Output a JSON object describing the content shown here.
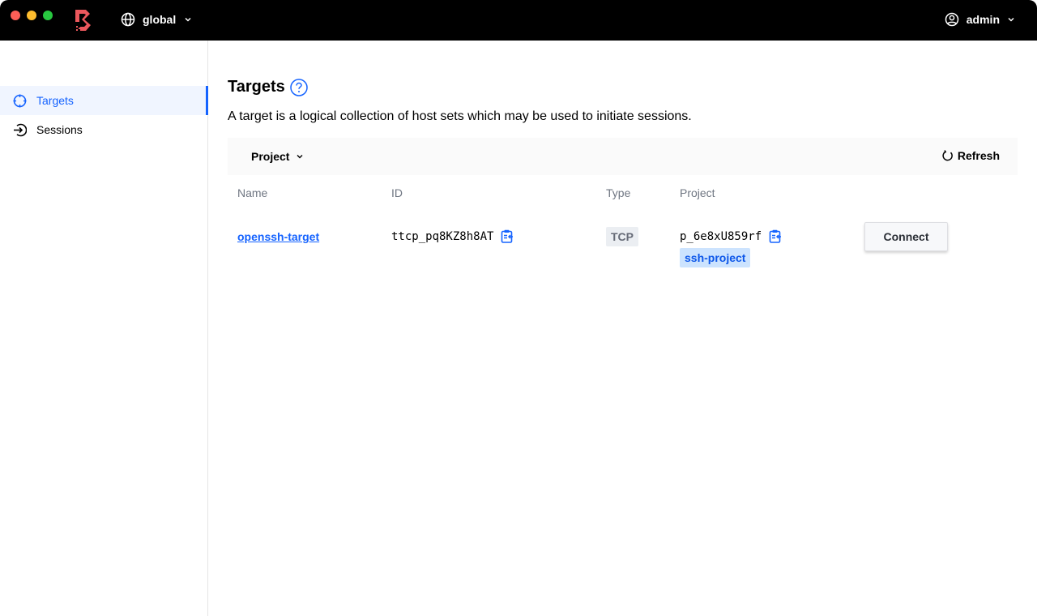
{
  "titlebar": {
    "scope_label": "global",
    "user_label": "admin",
    "brand_color": "#ec585d"
  },
  "sidebar": {
    "items": [
      {
        "label": "Targets",
        "icon": "target-icon",
        "active": true
      },
      {
        "label": "Sessions",
        "icon": "sign-in-icon",
        "active": false
      }
    ]
  },
  "main": {
    "title": "Targets",
    "description": "A target is a logical collection of host sets which may be used to initiate sessions.",
    "toolbar": {
      "filter_label": "Project",
      "refresh_label": "Refresh"
    },
    "table": {
      "columns": [
        "Name",
        "ID",
        "Type",
        "Project"
      ],
      "rows": [
        {
          "name": "openssh-target",
          "id": "ttcp_pq8KZ8h8AT",
          "type": "TCP",
          "project_id": "p_6e8xU859rf",
          "project_name": "ssh-project",
          "action_label": "Connect"
        }
      ]
    }
  },
  "colors": {
    "accent": "#1563ff",
    "active_bg": "#f0f5ff"
  }
}
